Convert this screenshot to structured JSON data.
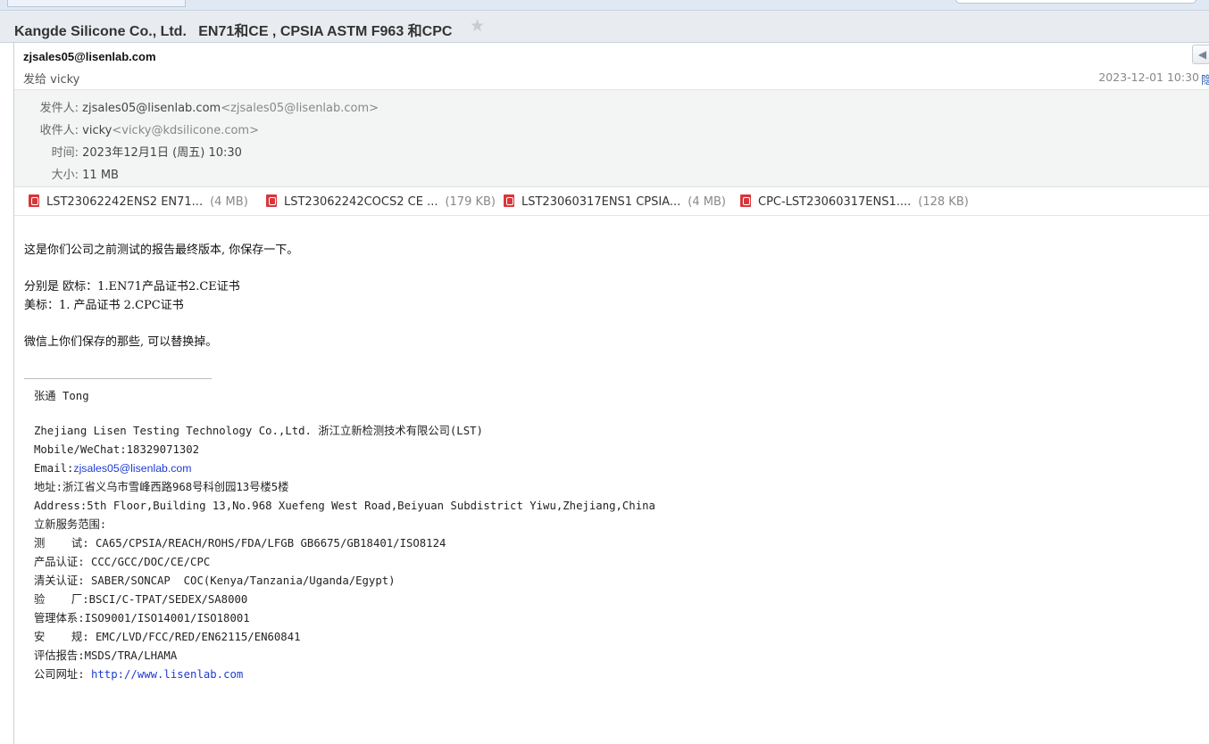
{
  "email": {
    "subject": "Kangde Silicone Co., Ltd.   EN71和CE , CPSIA ASTM F963 和CPC",
    "star_icon": "star-icon",
    "sender": "zjsales05@lisenlab.com",
    "send_to": "发给 vicky",
    "datetime": "2023-12-01 10:30",
    "hide_label": "隐藏",
    "details": {
      "from_label": "发件人:",
      "from_name": "zjsales05@lisenlab.com",
      "from_addr": "<zjsales05@lisenlab.com>",
      "to_label": "收件人:",
      "to_name": "vicky",
      "to_addr": "<vicky@kdsilicone.com>",
      "time_label": "时间:",
      "time_value": "2023年12月1日 (周五) 10:30",
      "size_label": "大小:",
      "size_value": "11 MB"
    },
    "attachments": [
      {
        "name": "LST23062242ENS2    EN71...",
        "size": "(4 MB)"
      },
      {
        "name": "LST23062242COCS2   CE ...",
        "size": "(179 KB)"
      },
      {
        "name": "LST23060317ENS1    CPSIA...",
        "size": "(4 MB)"
      },
      {
        "name": "CPC-LST23060317ENS1....",
        "size": "(128 KB)"
      }
    ],
    "body": {
      "line1": "这是你们公司之前测试的报告最终版本, 你保存一下。",
      "line2": "分别是 欧标：1.EN71产品证书2.CE证书",
      "line3": "美标：1. 产品证书 2.CPC证书",
      "line4": "微信上你们保存的那些, 可以替换掉。"
    },
    "signature": {
      "name": "张通 Tong",
      "company": "Zhejiang Lisen Testing Technology Co.,Ltd. 浙江立新检测技术有限公司(LST)",
      "mobile": "Mobile/WeChat:18329071302",
      "email_label": "Email:",
      "email_value": "zjsales05@lisenlab.com",
      "address_cn": "地址:浙江省义乌市雪峰西路968号科创园13号楼5楼",
      "address_en": "Address:5th Floor,Building 13,No.968 Xuefeng West Road,Beiyuan Subdistrict Yiwu,Zhejiang,China",
      "services_title": "立新服务范围:",
      "s1": "测    试: CA65/CPSIA/REACH/ROHS/FDA/LFGB GB6675/GB18401/ISO8124",
      "s2": "产品认证: CCC/GCC/DOC/CE/CPC",
      "s3": "清关认证: SABER/SONCAP  COC(Kenya/Tanzania/Uganda/Egypt)",
      "s4": "验    厂:BSCI/C-TPAT/SEDEX/SA8000",
      "s5": "管理体系:ISO9001/ISO14001/ISO18001",
      "s6": "安    规: EMC/LVD/FCC/RED/EN62115/EN60841",
      "s7": "评估报告:MSDS/TRA/LHAMA",
      "website_label": "公司网址: ",
      "website_url": "http://www.lisenlab.com"
    }
  },
  "icons": {
    "reply": "reply-arrow-icon",
    "attachment": "pdf-file-icon"
  }
}
